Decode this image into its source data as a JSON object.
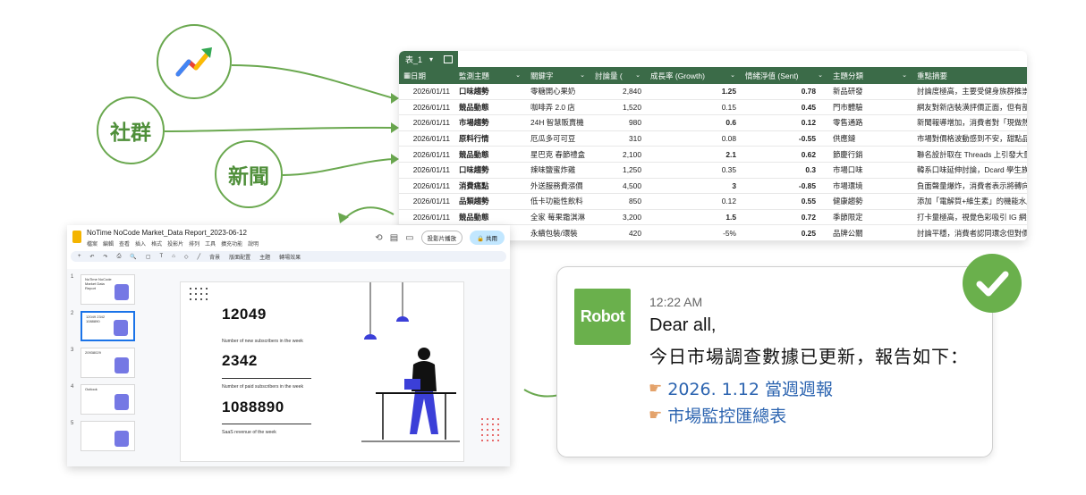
{
  "sources": {
    "trend_icon": "trending-arrow-icon",
    "social_label": "社群",
    "news_label": "新聞"
  },
  "sheet": {
    "tab_label": "表_1",
    "columns": [
      "日期",
      "監測主題",
      "關鍵字",
      "討論量 (",
      "成長率 (Growth)",
      "情緒淨值 (Sent)",
      "主題分類",
      "重點摘要"
    ],
    "rows": [
      [
        "2026/01/11",
        "口味趨勢",
        "零糖開心果奶",
        "2,840",
        "1.25",
        "0.78",
        "新品研發",
        "討論度極高，主要受健身族群推崇，"
      ],
      [
        "2026/01/11",
        "競品動態",
        "咖啡弄 2.0 店",
        "1,520",
        "0.15",
        "0.45",
        "門市體驗",
        "網友對新店裝潢評價正面，但有部分"
      ],
      [
        "2026/01/11",
        "市場趨勢",
        "24H 智慧販賣機",
        "980",
        "0.6",
        "0.12",
        "零售通路",
        "新聞報導增加，消費者對「現做熱食"
      ],
      [
        "2026/01/11",
        "原料行情",
        "厄瓜多可可豆",
        "310",
        "0.08",
        "-0.55",
        "供應鏈",
        "市場對價格波動感到不安，甜點品牌"
      ],
      [
        "2026/01/11",
        "競品動態",
        "星巴克 春節禮盒",
        "2,100",
        "2.1",
        "0.62",
        "節慶行銷",
        "聯名設計取在 Threads 上引發大量轉"
      ],
      [
        "2026/01/11",
        "口味趨勢",
        "辣味鹽蜜炸雞",
        "1,250",
        "0.35",
        "0.3",
        "市場口味",
        "韓系口味延伸討論，Dcard 學生族群"
      ],
      [
        "2026/01/11",
        "消費痛點",
        "外送服務費漲價",
        "4,500",
        "3",
        "-0.85",
        "市場環境",
        "負面聲量爆炸，消費者表示將轉向自"
      ],
      [
        "2026/01/11",
        "品類趨勢",
        "低卡功能性飲料",
        "850",
        "0.12",
        "0.55",
        "健康趨勢",
        "添加「電解質+維生素」的機能水成為"
      ],
      [
        "2026/01/11",
        "競品動態",
        "全家 莓果霜淇淋",
        "3,200",
        "1.5",
        "0.72",
        "季節限定",
        "打卡量極高，視覺色彩吸引 IG 網紅轉"
      ],
      [
        "",
        "",
        "永續包裝/環裝",
        "420",
        "-5%",
        "0.25",
        "品牌公關",
        "討論平穩，消費者認同環念但對價格"
      ]
    ]
  },
  "slides": {
    "doc_title": "NoTime NoCode Market_Data Report_2023-06-12",
    "menu": [
      "檔案",
      "編輯",
      "查看",
      "插入",
      "格式",
      "投影片",
      "排列",
      "工具",
      "擴充功能",
      "說明"
    ],
    "present_label": "投影片播放",
    "share_label": "共用",
    "toolbar": [
      "背景",
      "版面配置",
      "主題",
      "轉場效果"
    ],
    "thumbnails": [
      {
        "num": "1",
        "text": "NoTime NoCode Market Data Report"
      },
      {
        "num": "2",
        "text": "12049 2342 1088890"
      },
      {
        "num": "3",
        "text": "20938029"
      },
      {
        "num": "4",
        "text": "Outlook"
      },
      {
        "num": "5",
        "text": ""
      }
    ],
    "metrics": [
      {
        "value": "12049",
        "label": "Number of new subscribers in the week"
      },
      {
        "value": "2342",
        "label": "Number of paid subscribers in the week"
      },
      {
        "value": "1088890",
        "label": "SaaS revenue of the week"
      }
    ]
  },
  "chat": {
    "avatar_label": "Robot",
    "time": "12:22 AM",
    "greeting": "Dear all,",
    "body": "今日市場調查數據已更新，報告如下：",
    "links": [
      {
        "icon": "pointing-hand-icon",
        "label": "2026. 1.12 當週週報"
      },
      {
        "icon": "pointing-hand-icon",
        "label": "市場監控匯總表"
      }
    ]
  },
  "colors": {
    "accent_green": "#6ab04c",
    "sheet_header": "#3b6b48",
    "link_blue": "#2c64b0"
  }
}
